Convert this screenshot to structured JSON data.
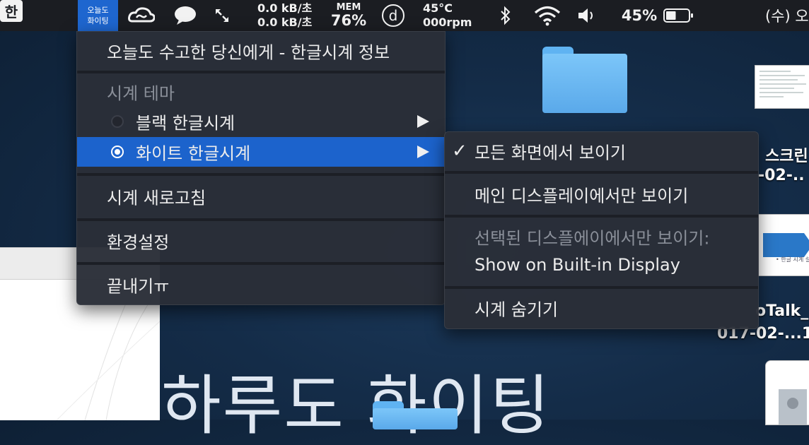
{
  "menubar": {
    "app_chip_line1": "오늘도",
    "app_chip_line2": "화이팅",
    "icons": [
      "creative-cloud-icon",
      "messages-icon",
      "resize-icon",
      "dictionary-icon",
      "bluetooth-icon",
      "wifi-icon",
      "volume-icon",
      "battery-icon"
    ],
    "net_up": "0.0 kB/초",
    "net_down": "0.0 kB/초",
    "mem_label": "MEM",
    "mem_value": "76%",
    "temp": "45°C",
    "fan": "000rpm",
    "battery_percent": "45%",
    "battery_level": 0.45,
    "input_source": "한",
    "clock": "(수) 오"
  },
  "main_menu": {
    "about": "오늘도 수고한 당신에게 - 한글시계 정보",
    "theme_header": "시계 테마",
    "theme_black": "블랙 한글시계",
    "theme_white": "화이트 한글시계",
    "refresh": "시계 새로고침",
    "preferences": "환경설정",
    "quit": "끝내기ㅠ"
  },
  "sub_menu": {
    "all_screens": "모든 화면에서 보이기",
    "main_display": "메인 디스플레이에서만 보이기",
    "selected_header": "선택된 디스플에이에서만 보이기:",
    "builtin": "Show on Built-in Display",
    "hide": "시계 숨기기"
  },
  "desktop": {
    "label1a": "스크린",
    "label1b": "-02-..",
    "label2a": "oTalk_",
    "label2b": "017-02-...1",
    "big_text": "하루도 화이팅",
    "thumb_caption": "• 한글 시계 설치"
  },
  "colors": {
    "highlight": "#1c63cc",
    "app_chip": "#1e66cf",
    "menubar": "#1b1d22"
  }
}
